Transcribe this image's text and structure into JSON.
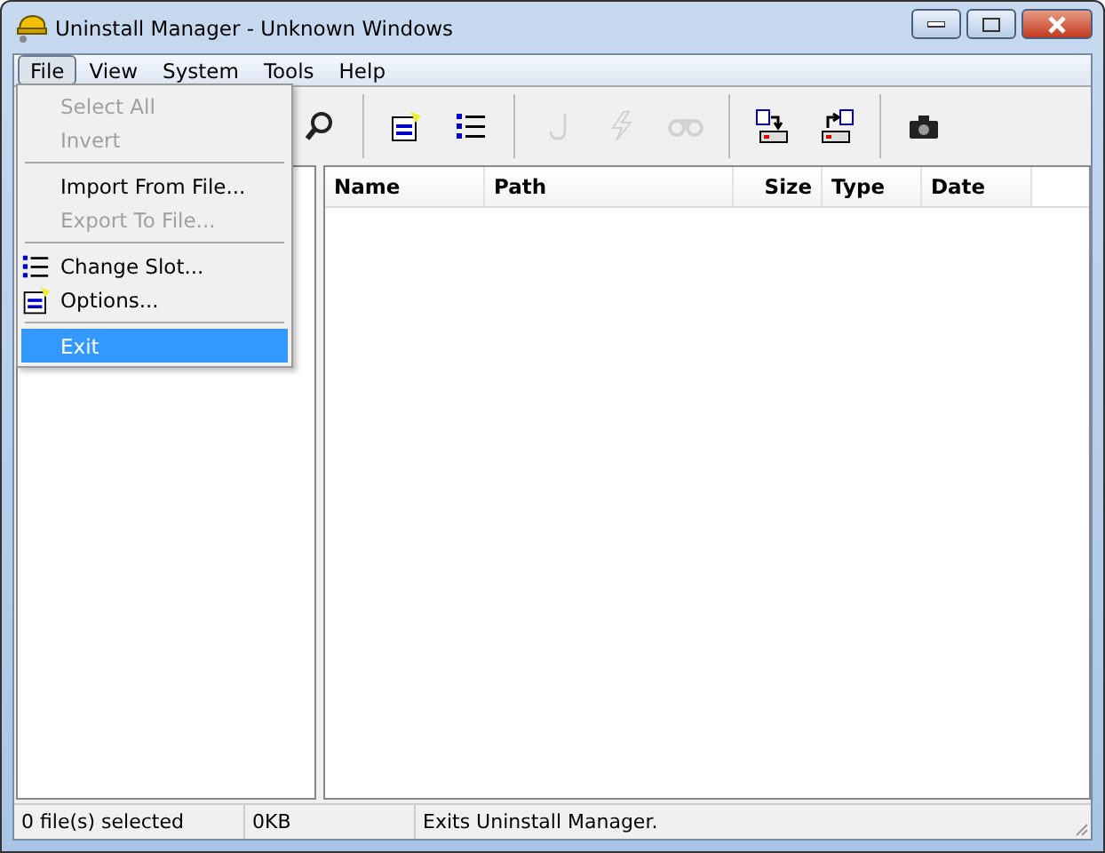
{
  "window": {
    "title": "Uninstall Manager - Unknown Windows"
  },
  "menu_bar": [
    {
      "label": "File",
      "selected": true
    },
    {
      "label": "View",
      "selected": false
    },
    {
      "label": "System",
      "selected": false
    },
    {
      "label": "Tools",
      "selected": false
    },
    {
      "label": "Help",
      "selected": false
    }
  ],
  "toolbar": [
    {
      "kind": "search",
      "disabled": false
    },
    {
      "kind": "separator"
    },
    {
      "kind": "properties",
      "disabled": false
    },
    {
      "kind": "list",
      "disabled": false
    },
    {
      "kind": "separator"
    },
    {
      "kind": "hook",
      "disabled": true
    },
    {
      "kind": "lightning",
      "disabled": true
    },
    {
      "kind": "binoculars",
      "disabled": true
    },
    {
      "kind": "separator"
    },
    {
      "kind": "export",
      "disabled": false
    },
    {
      "kind": "import",
      "disabled": false
    },
    {
      "kind": "separator"
    },
    {
      "kind": "camera",
      "disabled": false
    }
  ],
  "file_menu": [
    {
      "kind": "item",
      "label": "Select All",
      "disabled": true,
      "selected": false
    },
    {
      "kind": "item",
      "label": "Invert",
      "disabled": true,
      "selected": false
    },
    {
      "kind": "separator"
    },
    {
      "kind": "item",
      "label": "Import From File...",
      "disabled": false,
      "selected": false
    },
    {
      "kind": "item",
      "label": "Export To File...",
      "disabled": true,
      "selected": false
    },
    {
      "kind": "separator"
    },
    {
      "kind": "list_item",
      "label": "Change Slot...",
      "disabled": false,
      "selected": false
    },
    {
      "kind": "options_item",
      "label": "Options...",
      "disabled": false,
      "selected": false
    },
    {
      "kind": "separator"
    },
    {
      "kind": "item",
      "label": "Exit",
      "disabled": false,
      "selected": true
    }
  ],
  "table": {
    "columns": [
      {
        "label": "Name"
      },
      {
        "label": "Path"
      },
      {
        "label": "Size"
      },
      {
        "label": "Type"
      },
      {
        "label": "Date"
      }
    ]
  },
  "status_bar": [
    "0 file(s) selected",
    "0KB",
    "Exits Uninstall Manager."
  ]
}
